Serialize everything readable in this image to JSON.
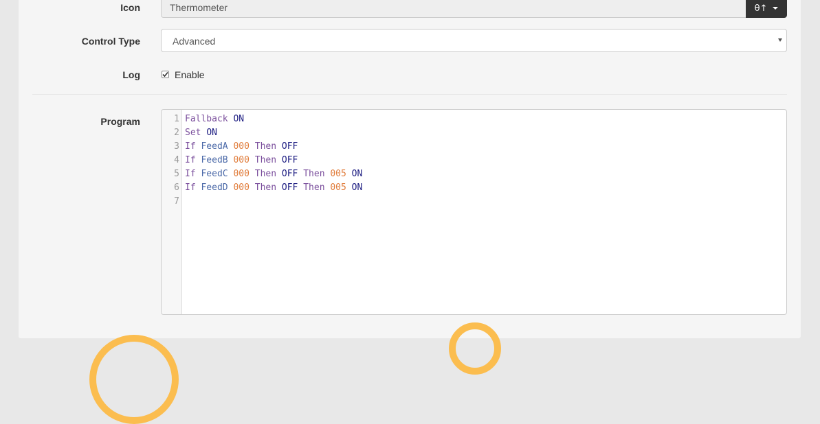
{
  "form": {
    "icon": {
      "label": "Icon",
      "value": "Thermometer",
      "button_glyph": "θ↑",
      "button_icon": "thermometer-icon"
    },
    "control_type": {
      "label": "Control Type",
      "selected": "Advanced"
    },
    "log": {
      "label": "Log",
      "checkbox_label": "Enable",
      "checked": true
    },
    "program": {
      "label": "Program",
      "lines": [
        {
          "n": "1",
          "tokens": [
            [
              "kw",
              "Fallback"
            ],
            [
              "sp",
              " "
            ],
            [
              "val",
              "ON"
            ]
          ]
        },
        {
          "n": "2",
          "tokens": [
            [
              "kw",
              "Set"
            ],
            [
              "sp",
              " "
            ],
            [
              "val",
              "ON"
            ]
          ]
        },
        {
          "n": "3",
          "tokens": [
            [
              "kw",
              "If"
            ],
            [
              "sp",
              " "
            ],
            [
              "var",
              "FeedA"
            ],
            [
              "sp",
              " "
            ],
            [
              "num",
              "000"
            ],
            [
              "sp",
              " "
            ],
            [
              "kw",
              "Then"
            ],
            [
              "sp",
              " "
            ],
            [
              "val",
              "OFF"
            ]
          ]
        },
        {
          "n": "4",
          "tokens": [
            [
              "kw",
              "If"
            ],
            [
              "sp",
              " "
            ],
            [
              "var",
              "FeedB"
            ],
            [
              "sp",
              " "
            ],
            [
              "num",
              "000"
            ],
            [
              "sp",
              " "
            ],
            [
              "kw",
              "Then"
            ],
            [
              "sp",
              " "
            ],
            [
              "val",
              "OFF"
            ]
          ]
        },
        {
          "n": "5",
          "tokens": [
            [
              "kw",
              "If"
            ],
            [
              "sp",
              " "
            ],
            [
              "var",
              "FeedC"
            ],
            [
              "sp",
              " "
            ],
            [
              "num",
              "000"
            ],
            [
              "sp",
              " "
            ],
            [
              "kw",
              "Then"
            ],
            [
              "sp",
              " "
            ],
            [
              "val",
              "OFF"
            ],
            [
              "sp",
              " "
            ],
            [
              "kw",
              "Then"
            ],
            [
              "sp",
              " "
            ],
            [
              "num",
              "005"
            ],
            [
              "sp",
              " "
            ],
            [
              "val",
              "ON"
            ]
          ]
        },
        {
          "n": "6",
          "tokens": [
            [
              "kw",
              "If"
            ],
            [
              "sp",
              " "
            ],
            [
              "var",
              "FeedD"
            ],
            [
              "sp",
              " "
            ],
            [
              "num",
              "000"
            ],
            [
              "sp",
              " "
            ],
            [
              "kw",
              "Then"
            ],
            [
              "sp",
              " "
            ],
            [
              "val",
              "OFF"
            ],
            [
              "sp",
              " "
            ],
            [
              "kw",
              "Then"
            ],
            [
              "sp",
              " "
            ],
            [
              "num",
              "005"
            ],
            [
              "sp",
              " "
            ],
            [
              "val",
              "ON"
            ]
          ]
        },
        {
          "n": "7",
          "tokens": []
        }
      ]
    }
  },
  "colors": {
    "keyword": "#7a4e9c",
    "variable": "#4b69a8",
    "number": "#e07b39",
    "value": "#1a1a80",
    "accent": "#fbbd4f"
  }
}
